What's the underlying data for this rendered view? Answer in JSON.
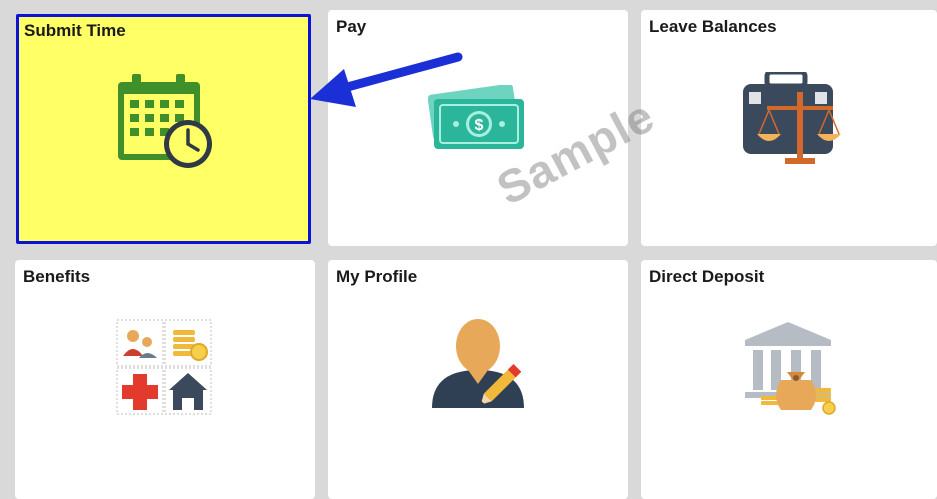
{
  "tiles": {
    "submit_time": {
      "title": "Submit Time",
      "icon": "calendar-clock-icon"
    },
    "pay": {
      "title": "Pay",
      "icon": "money-bill-icon"
    },
    "leave_balances": {
      "title": "Leave Balances",
      "icon": "briefcase-scales-icon"
    },
    "benefits": {
      "title": "Benefits",
      "icon": "benefits-grid-icon"
    },
    "my_profile": {
      "title": "My Profile",
      "icon": "person-pencil-icon"
    },
    "direct_deposit": {
      "title": "Direct Deposit",
      "icon": "bank-moneybag-icon"
    }
  },
  "watermark": "Sample",
  "colors": {
    "highlight_bg": "#ffff66",
    "highlight_border": "#0b13d6",
    "arrow": "#1a2fd6"
  }
}
